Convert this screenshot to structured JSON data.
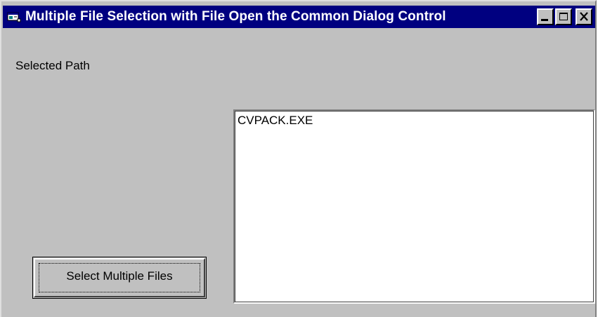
{
  "window": {
    "title": "Multiple File Selection with File Open the Common Dialog Control",
    "icon": "app-icon",
    "controls": {
      "minimize": "minimize-icon",
      "maximize": "maximize-icon",
      "close": "close-icon"
    }
  },
  "form": {
    "selected_path_label": "Selected Path",
    "file_list": {
      "items": [
        "CVPACK.EXE"
      ]
    },
    "select_button_label": "Select Multiple Files"
  },
  "colors": {
    "titlebar": "#000080",
    "face": "#c0c0c0",
    "list_background": "#ffffff"
  }
}
